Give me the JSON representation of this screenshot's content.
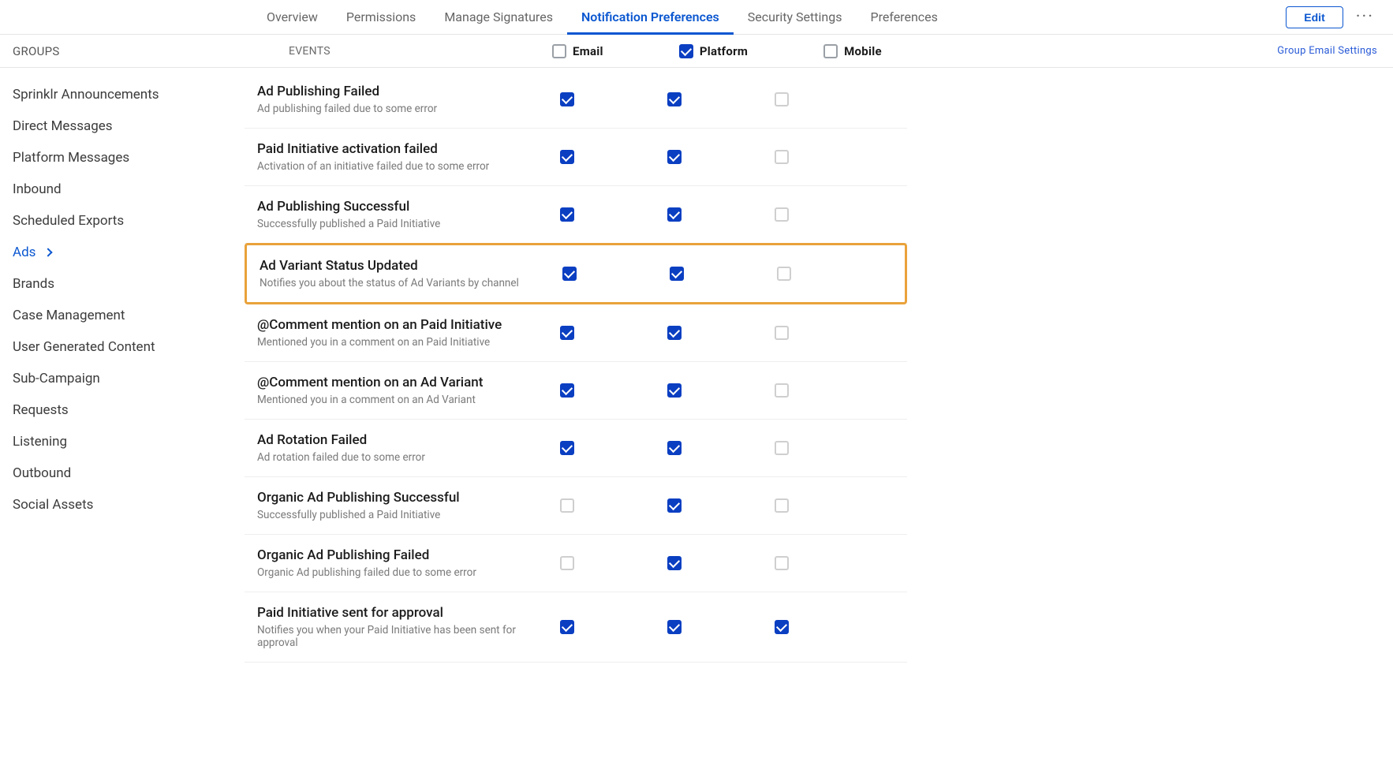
{
  "topNav": {
    "tabs": [
      "Overview",
      "Permissions",
      "Manage Signatures",
      "Notification Preferences",
      "Security Settings",
      "Preferences"
    ],
    "activeIndex": 3,
    "editLabel": "Edit"
  },
  "headerRow": {
    "groupsLabel": "GROUPS",
    "eventsLabel": "EVENTS",
    "columns": [
      {
        "label": "Email",
        "checked": false
      },
      {
        "label": "Platform",
        "checked": true
      },
      {
        "label": "Mobile",
        "checked": false
      }
    ],
    "link": "Group Email Settings"
  },
  "sidebar": {
    "items": [
      {
        "label": "Sprinklr Announcements"
      },
      {
        "label": "Direct Messages"
      },
      {
        "label": "Platform Messages"
      },
      {
        "label": "Inbound"
      },
      {
        "label": "Scheduled Exports"
      },
      {
        "label": "Ads",
        "active": true
      },
      {
        "label": "Brands"
      },
      {
        "label": "Case Management"
      },
      {
        "label": "User Generated Content"
      },
      {
        "label": "Sub-Campaign"
      },
      {
        "label": "Requests"
      },
      {
        "label": "Listening"
      },
      {
        "label": "Outbound"
      },
      {
        "label": "Social Assets"
      }
    ]
  },
  "events": [
    {
      "title": "Ad Publishing Failed",
      "desc": "Ad publishing failed due to some error",
      "email": true,
      "platform": true,
      "mobile": false,
      "highlight": false
    },
    {
      "title": "Paid Initiative activation failed",
      "desc": "Activation of an initiative failed due to some error",
      "email": true,
      "platform": true,
      "mobile": false,
      "highlight": false
    },
    {
      "title": "Ad Publishing Successful",
      "desc": "Successfully published a Paid Initiative",
      "email": true,
      "platform": true,
      "mobile": false,
      "highlight": false
    },
    {
      "title": "Ad Variant Status Updated",
      "desc": "Notifies you about the status of Ad Variants by channel",
      "email": true,
      "platform": true,
      "mobile": false,
      "highlight": true
    },
    {
      "title": "@Comment mention on an Paid Initiative",
      "desc": "Mentioned you in a comment on an Paid Initiative",
      "email": true,
      "platform": true,
      "mobile": false,
      "highlight": false
    },
    {
      "title": "@Comment mention on an Ad Variant",
      "desc": "Mentioned you in a comment on an Ad Variant",
      "email": true,
      "platform": true,
      "mobile": false,
      "highlight": false
    },
    {
      "title": "Ad Rotation Failed",
      "desc": "Ad rotation failed due to some error",
      "email": true,
      "platform": true,
      "mobile": false,
      "highlight": false
    },
    {
      "title": "Organic Ad Publishing Successful",
      "desc": "Successfully published a Paid Initiative",
      "email": false,
      "platform": true,
      "mobile": false,
      "highlight": false
    },
    {
      "title": "Organic Ad Publishing Failed",
      "desc": "Organic Ad publishing failed due to some error",
      "email": false,
      "platform": true,
      "mobile": false,
      "highlight": false
    },
    {
      "title": "Paid Initiative sent for approval",
      "desc": "Notifies you when your Paid Initiative has been sent for approval",
      "email": true,
      "platform": true,
      "mobile": true,
      "highlight": false
    }
  ]
}
